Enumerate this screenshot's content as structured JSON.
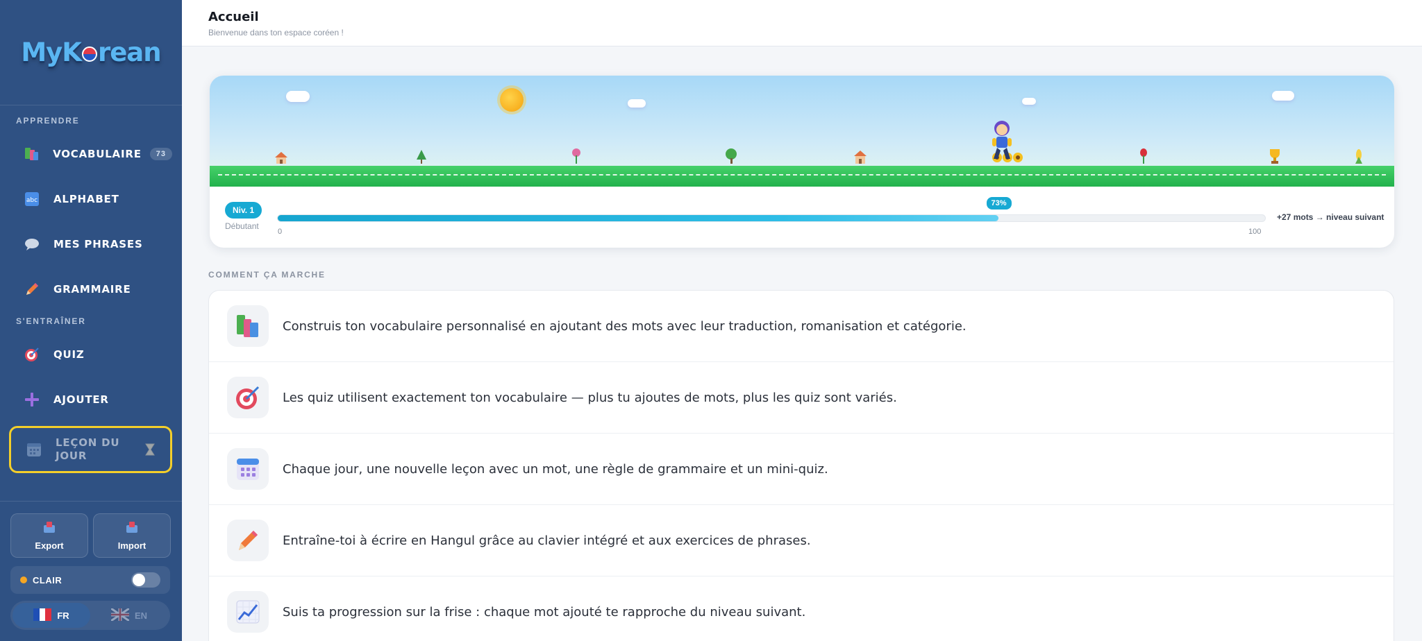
{
  "app": {
    "logo_prefix": "MyK",
    "logo_suffix": "rean"
  },
  "sidebar": {
    "section_learn": "APPRENDRE",
    "section_train": "S'ENTRAÎNER",
    "items": [
      {
        "label": "VOCABULAIRE",
        "badge": "73",
        "icon": "books-icon"
      },
      {
        "label": "ALPHABET",
        "icon": "abc-icon"
      },
      {
        "label": "MES PHRASES",
        "icon": "speech-bubble-icon"
      },
      {
        "label": "GRAMMAIRE",
        "icon": "pencil-icon"
      },
      {
        "label": "QUIZ",
        "icon": "target-icon"
      },
      {
        "label": "AJOUTER",
        "icon": "plus-icon"
      },
      {
        "label": "LEÇON DU JOUR",
        "icon": "calendar-icon",
        "status_icon": "hourglass-icon"
      }
    ],
    "export_label": "Export",
    "import_label": "Import",
    "theme_label": "CLAIR",
    "theme_dark_enabled": false,
    "languages": [
      {
        "code": "FR",
        "active": true
      },
      {
        "code": "EN",
        "active": false
      }
    ]
  },
  "header": {
    "title": "Accueil",
    "subtitle": "Bienvenue dans ton espace coréen !"
  },
  "progress": {
    "level_badge": "Niv. 1",
    "level_name": "Débutant",
    "percent": 73,
    "percent_label": "73%",
    "min_label": "0",
    "max_label": "100",
    "next_level_text": "+27 mots → niveau suivant"
  },
  "how_it_works": {
    "label": "COMMENT ÇA MARCHE",
    "items": [
      {
        "icon": "books-icon",
        "text": "Construis ton vocabulaire personnalisé en ajoutant des mots avec leur traduction, romanisation et catégorie."
      },
      {
        "icon": "target-icon",
        "text": "Les quiz utilisent exactement ton vocabulaire — plus tu ajoutes de mots, plus les quiz sont variés."
      },
      {
        "icon": "calendar-icon",
        "text": "Chaque jour, une nouvelle leçon avec un mot, une règle de grammaire et un mini-quiz."
      },
      {
        "icon": "pencil-icon",
        "text": "Entraîne-toi à écrire en Hangul grâce au clavier intégré et aux exercices de phrases."
      },
      {
        "icon": "chart-icon",
        "text": "Suis ta progression sur la frise : chaque mot ajouté te rapproche du niveau suivant."
      }
    ]
  },
  "colors": {
    "sidebar": "#2f5183",
    "accent": "#17a9d3",
    "highlight": "#f4cf2a"
  }
}
